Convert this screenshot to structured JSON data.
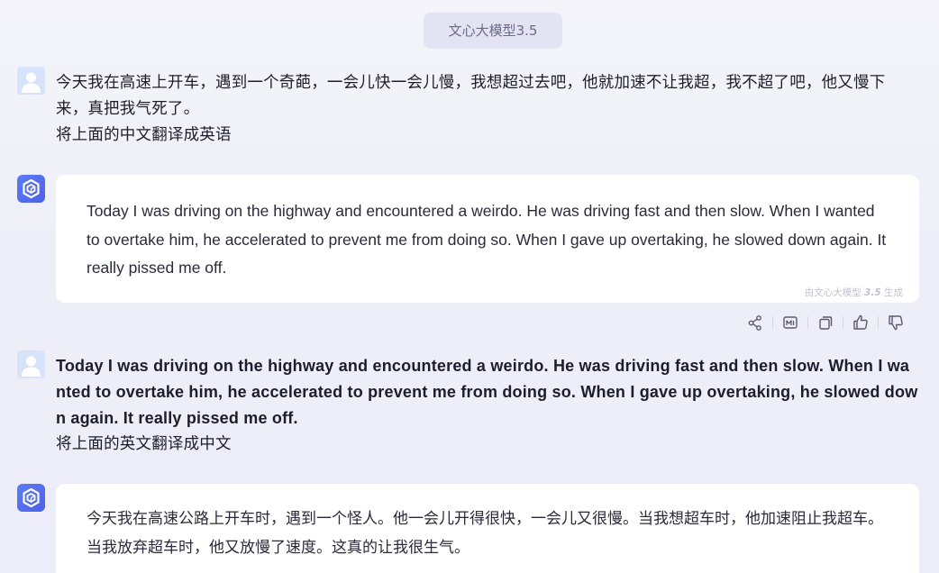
{
  "header": {
    "model_label": "文心大模型3.5"
  },
  "messages": [
    {
      "role": "user",
      "lines": [
        "今天我在高速上开车，遇到一个奇葩，一会儿快一会儿慢，我想超过去吧，他就加速不让我超，我不超了吧，他又慢下",
        "来，真把我气死了。",
        "将上面的中文翻译成英语"
      ]
    },
    {
      "role": "assistant",
      "text": "Today I was driving on the highway and encountered a weirdo. He was driving fast and then slow. When I wanted to overtake him, he accelerated to prevent me from doing so. When I gave up overtaking, he slowed down again. It really pissed me off.",
      "watermark_prefix": "由文心大模型",
      "watermark_version": "3.5",
      "watermark_suffix": "生成"
    },
    {
      "role": "user",
      "english_text": "Today I was driving on the highway and encountered a weirdo. He was driving fast and then slow. When I wanted to overtake him, he accelerated to prevent me from doing so. When I gave up overtaking, he slowed down again. It really pissed me off.",
      "instruction": "将上面的英文翻译成中文"
    },
    {
      "role": "assistant",
      "text": "今天我在高速公路上开车时，遇到一个怪人。他一会儿开得很快，一会儿又很慢。当我想超车时，他加速阻止我超车。当我放弃超车时，他又放慢了速度。这真的让我很生气。"
    }
  ],
  "actions": {
    "icons": [
      "share-icon",
      "mindmap-icon",
      "copy-icon",
      "thumbs-up-icon",
      "thumbs-down-icon"
    ]
  },
  "colors": {
    "accent": "#4e60e6",
    "user_avatar": "#d6e3fb",
    "card_bg": "#ffffff",
    "page_bg": "#f0f0f8"
  }
}
